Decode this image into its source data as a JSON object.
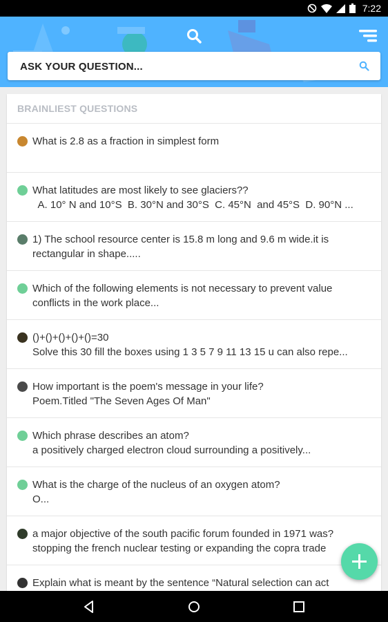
{
  "status_bar": {
    "time": "7:22"
  },
  "search": {
    "placeholder": "ASK YOUR QUESTION..."
  },
  "section": {
    "title": "BRAINLIEST QUESTIONS"
  },
  "colors": {
    "header": "#4fb3ff",
    "fab": "#55d9a9",
    "section_title": "#b9bdc4"
  },
  "questions": [
    {
      "line1": "What is 2.8 as a fraction in simplest form",
      "line2": "",
      "avatar_color": "#c8872f"
    },
    {
      "line1": "What latitudes are most likely to see glaciers??",
      "line2": "  A. 10° N and 10°S  B. 30°N and 30°S  C. 45°N  and 45°S  D. 90°N ...",
      "avatar_color": "#6fcf97"
    },
    {
      "line1": "1) The school resource center is 15.8 m long and 9.6 m wide.it is",
      "line2": "rectangular in shape.....",
      "avatar_color": "#5a7d6a"
    },
    {
      "line1": "Which of the following elements is not necessary to prevent value",
      "line2": "conflicts in the work place...",
      "avatar_color": "#6fcf97"
    },
    {
      "line1": "()+()+()+()+()=30",
      "line2": "Solve this 30 fill the boxes using 1 3 5 7 9 11 13 15 u can also repe...",
      "avatar_color": "#3a3320"
    },
    {
      "line1": "How important is the poem's message in your life?",
      "line2": "Poem.Titled \"The Seven Ages Of Man\"",
      "avatar_color": "#4a4a4a"
    },
    {
      "line1": "Which phrase describes an atom?",
      "line2": "a positively charged electron cloud surrounding a positively...",
      "avatar_color": "#6fcf97"
    },
    {
      "line1": "What is the charge of the nucleus of an oxygen atom?",
      "line2": "O...",
      "avatar_color": "#6fcf97"
    },
    {
      "line1": "a major objective of the south pacific forum founded in 1971 was?",
      "line2": "stopping the french nuclear testing or expanding the copra trade",
      "avatar_color": "#2f3b2a"
    },
    {
      "line1": "Explain what is meant by the sentence “Natural selection can act",
      "line2": "",
      "avatar_color": "#333333"
    }
  ]
}
